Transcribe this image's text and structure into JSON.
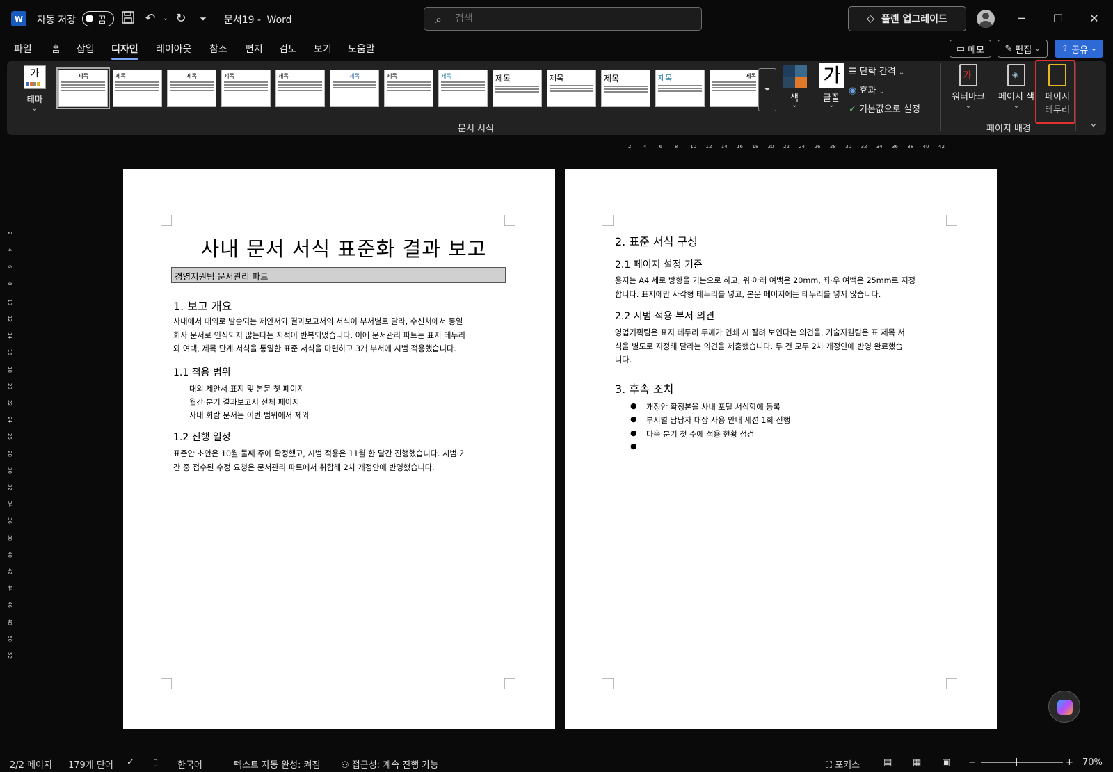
{
  "titlebar": {
    "app_logo": "W",
    "autosave_label": "자동 저장",
    "autosave_state": "끔",
    "doc_name": "문서19",
    "separator": "-",
    "app_name": "Word",
    "search_placeholder": "검색",
    "upgrade_label": "플랜 업그레이드"
  },
  "menu": {
    "tabs": [
      "파일",
      "홈",
      "삽입",
      "디자인",
      "레이아웃",
      "참조",
      "편지",
      "검토",
      "보기",
      "도움말"
    ],
    "active_tab": "디자인",
    "memo_label": "메모",
    "edit_label": "편집",
    "share_label": "공유"
  },
  "ribbon": {
    "theme_label": "테마",
    "theme_icon_text": "가",
    "style_thumbs": [
      "제목",
      "제목",
      "제목",
      "제목",
      "제목",
      "제목",
      "제목",
      "제목",
      "제목",
      "제목",
      "제목",
      "제목",
      "제목"
    ],
    "group_doc_format": "문서 서식",
    "colors_label": "색",
    "fonts_label": "글꼴",
    "font_icon_text": "가",
    "paragraph_spacing": "단락 간격",
    "effects": "효과",
    "set_default": "기본값으로 설정",
    "watermark": "워터마크",
    "page_color": "페이지 색",
    "page_border_line1": "페이지",
    "page_border_line2": "테두리",
    "group_page_bg": "페이지 배경",
    "watermark_glyph": "가"
  },
  "ruler": {
    "h_ticks": [
      "2",
      "4",
      "6",
      "8",
      "10",
      "12",
      "14",
      "16",
      "18",
      "20",
      "22",
      "24",
      "26",
      "28",
      "30",
      "32",
      "34",
      "36",
      "38",
      "40",
      "42"
    ],
    "v_ticks": [
      "2",
      "4",
      "6",
      "8",
      "10",
      "12",
      "14",
      "16",
      "18",
      "20",
      "22",
      "24",
      "26",
      "28",
      "30",
      "32",
      "34",
      "36",
      "38",
      "40",
      "42",
      "44",
      "46",
      "48",
      "50",
      "52"
    ]
  },
  "page1": {
    "title": "사내 문서 서식 표준화 결과 보고",
    "subtitle": "경영지원팀 문서관리 파트",
    "h1_overview": "1. 보고 개요",
    "overview_lines": [
      "사내에서 대외로 발송되는 제안서와 결과보고서의 서식이 부서별로 달라, 수신처에서 동일",
      "회사 문서로 인식되지 않는다는 지적이 반복되었습니다. 이에 문서관리 파트는 표지 테두리",
      "와 여백, 제목 단계 서식을 통일한 표준 서식을 마련하고 3개 부서에 시범 적용했습니다."
    ],
    "h2_scope": "1.1 적용 범위",
    "scope_items": [
      "대외 제안서 표지 및 본문 첫 페이지",
      "월간·분기 결과보고서 전체 페이지",
      "사내 회람 문서는 이번 범위에서 제외"
    ],
    "h2_schedule": "1.2 진행 일정",
    "schedule_lines": [
      "표준안 초안은 10월 둘째 주에 확정했고, 시범 적용은 11월 한 달간 진행했습니다. 시범 기",
      "간 중 접수된 수정 요청은 문서관리 파트에서 취합해 2차 개정안에 반영했습니다."
    ]
  },
  "page2": {
    "h1_structure": "2. 표준 서식 구성",
    "h2_page_setup": "2.1 페이지 설정 기준",
    "page_setup_lines": [
      "용지는 A4 세로 방향을 기본으로 하고, 위·아래 여백은 20mm, 좌·우 여백은 25mm로 지정",
      "합니다. 표지에만 사각형 테두리를 넣고, 본문 페이지에는 테두리를 넣지 않습니다."
    ],
    "h2_feedback": "2.2 시범 적용 부서 의견",
    "feedback_lines": [
      "영업기획팀은 표지 테두리 두께가 인쇄 시 잘려 보인다는 의견을, 기술지원팀은 표 제목 서",
      "식을 별도로 지정해 달라는 의견을 제출했습니다. 두 건 모두 2차 개정안에 반영 완료했습",
      "니다."
    ],
    "h1_followup": "3. 후속 조치",
    "followup_items": [
      "개정안 확정본을 사내 포털 서식함에 등록",
      "부서별 담당자 대상 사용 안내 세션 1회 진행",
      "다음 분기 첫 주에 적용 현황 점검",
      ""
    ],
    "bullet_glyph": "●"
  },
  "status": {
    "page": "2/2 페이지",
    "words": "179개 단어",
    "language": "한국어",
    "autocomplete": "텍스트 자동 완성: 켜짐",
    "accessibility": "접근성: 계속 진행 가능",
    "focus": "포커스",
    "zoom": "70%"
  },
  "colors": {
    "accent": "#7aa6f5",
    "share_bg": "#2d6ad6",
    "highlight": "#e03030"
  }
}
